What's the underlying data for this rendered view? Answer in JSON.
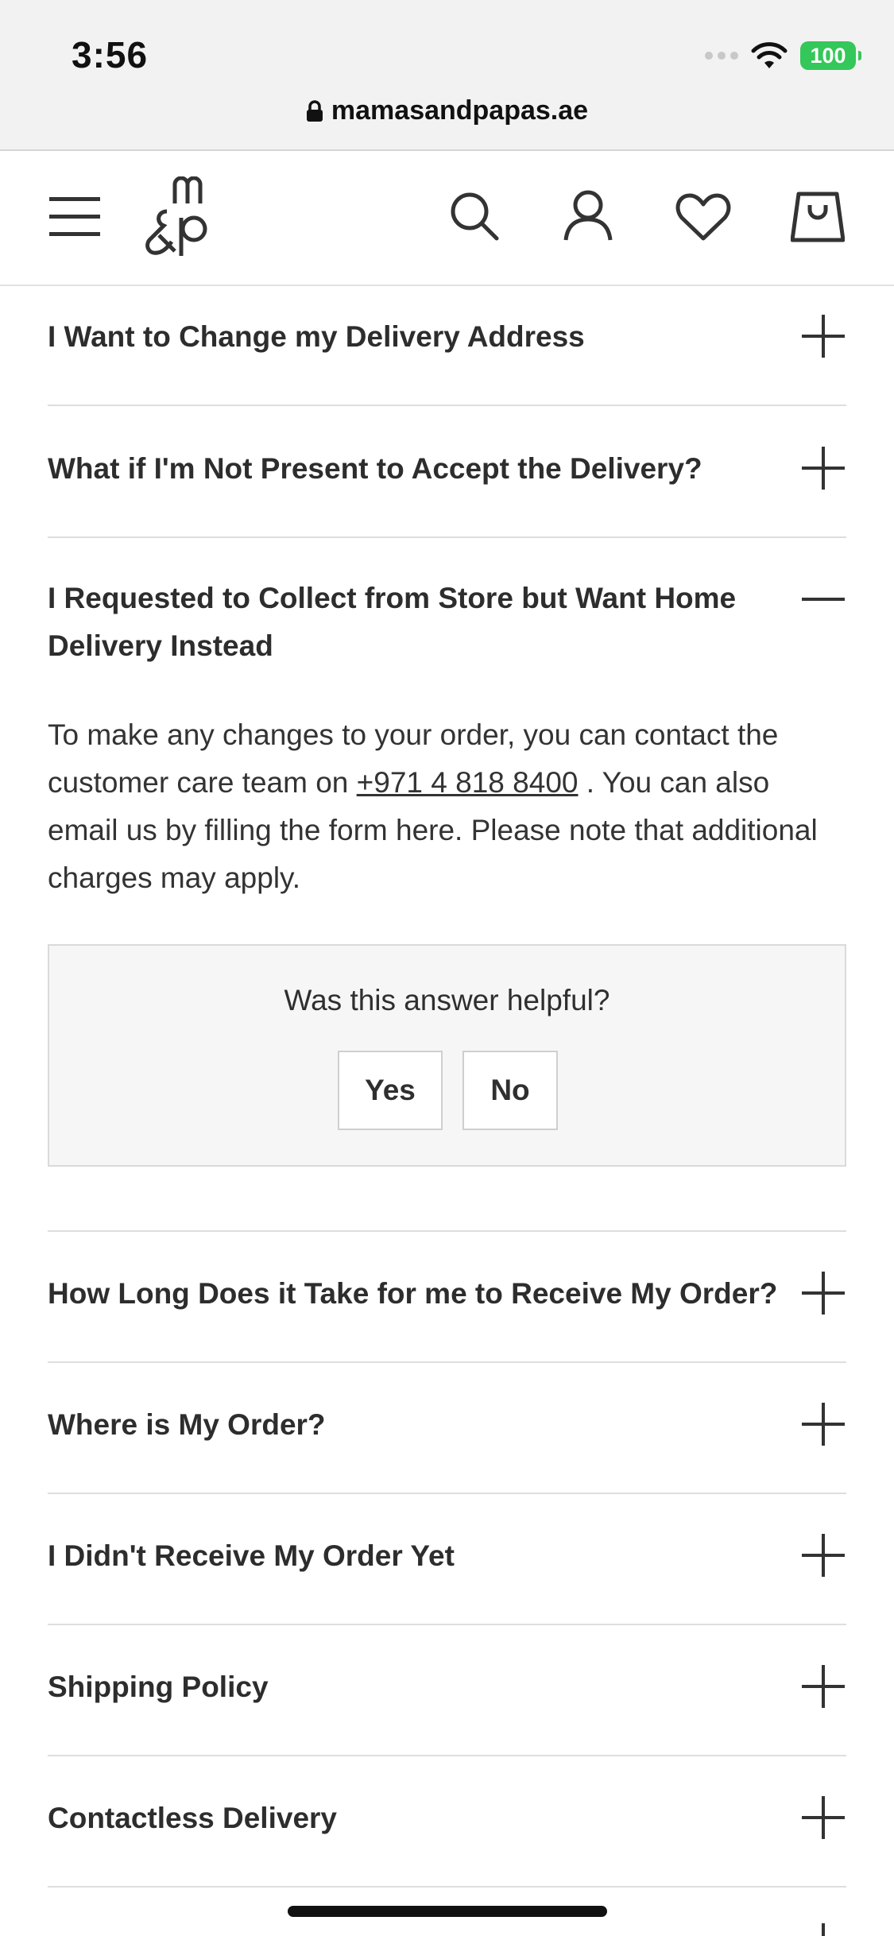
{
  "status_bar": {
    "time": "3:56",
    "battery": "100"
  },
  "browser": {
    "url": "mamasandpapas.ae"
  },
  "header": {
    "icons": [
      "menu-icon",
      "logo",
      "search-icon",
      "account-icon",
      "heart-icon",
      "shopping-bag-icon"
    ]
  },
  "faq": {
    "items": [
      {
        "question": "I Want to Change my Delivery Address",
        "expanded": false
      },
      {
        "question": "What if I'm Not Present to Accept the Delivery?",
        "expanded": false
      },
      {
        "question": "I Requested to Collect from Store but Want Home Delivery Instead",
        "expanded": true
      },
      {
        "question": "How Long Does it Take for me to Receive My Order?",
        "expanded": false
      },
      {
        "question": "Where is My Order?",
        "expanded": false
      },
      {
        "question": "I Didn't Receive My Order Yet",
        "expanded": false
      },
      {
        "question": "Shipping Policy",
        "expanded": false
      },
      {
        "question": "Contactless Delivery",
        "expanded": false
      }
    ],
    "answer": {
      "before_phone": "To make any changes to your order, you can contact the customer care team on ",
      "phone": "+971 4 818 8400",
      "after_phone": " . You can also email us by filling the form here. Please note that additional charges may apply."
    },
    "helpful": {
      "title": "Was this answer helpful?",
      "yes": "Yes",
      "no": "No"
    }
  },
  "colors": {
    "text": "#2d2d2d",
    "divider": "#dedede",
    "battery": "#34c759",
    "panel_bg": "#f6f6f6"
  }
}
